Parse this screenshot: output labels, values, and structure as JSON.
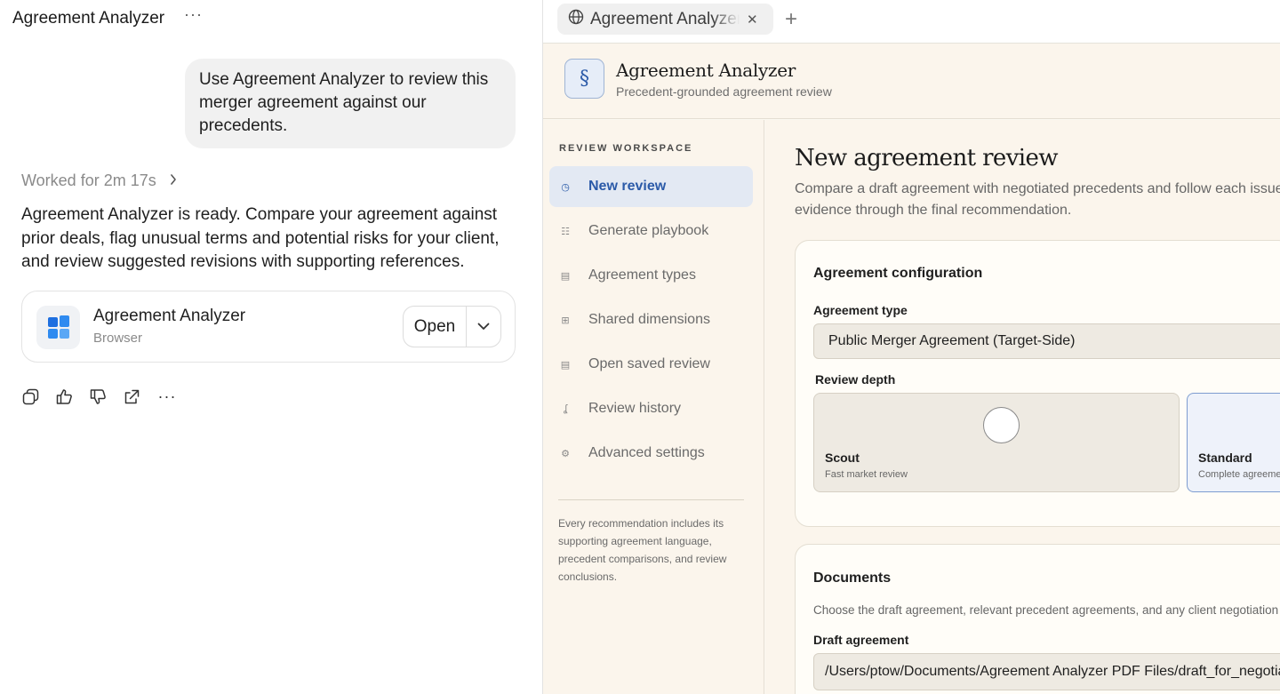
{
  "chat": {
    "title": "Agreement Analyzer",
    "more_glyph": "···",
    "user_message": "Use Agreement Analyzer to review this merger agreement against our precedents.",
    "worked_label": "Worked for 2m 17s",
    "assistant_message": "Agreement Analyzer is ready. Compare your agreement against prior deals, flag unusual terms and potential risks for your client, and review suggested revisions with supporting references.",
    "card": {
      "name": "Agreement Analyzer",
      "subtitle": "Browser",
      "open_label": "Open",
      "icon": "app-grid-icon"
    },
    "actions": [
      "copy-icon",
      "thumbs-up-icon",
      "thumbs-down-icon",
      "share-icon",
      "more-icon"
    ],
    "more_actions_glyph": "···"
  },
  "browser": {
    "tab_label": "Agreement Analyzer",
    "close_glyph": "✕",
    "new_tab_glyph": "+",
    "app": {
      "logo_glyph": "§",
      "title": "Agreement Analyzer",
      "subtitle": "Precedent-grounded agreement review"
    },
    "sidebar": {
      "heading": "REVIEW WORKSPACE",
      "items": [
        {
          "label": "New review",
          "icon": "clock-icon",
          "glyph": "◷",
          "active": true
        },
        {
          "label": "Generate playbook",
          "icon": "list-icon",
          "glyph": "☷",
          "active": false
        },
        {
          "label": "Agreement types",
          "icon": "document-icon",
          "glyph": "▤",
          "active": false
        },
        {
          "label": "Shared dimensions",
          "icon": "grid-icon",
          "glyph": "⊞",
          "active": false
        },
        {
          "label": "Open saved review",
          "icon": "folder-icon",
          "glyph": "▤",
          "active": false
        },
        {
          "label": "Review history",
          "icon": "history-icon",
          "glyph": "ʆ",
          "active": false
        },
        {
          "label": "Advanced settings",
          "icon": "gear-icon",
          "glyph": "⚙",
          "active": false
        }
      ],
      "note": "Every recommendation includes its supporting agreement language, precedent comparisons, and review conclusions."
    },
    "main": {
      "title": "New agreement review",
      "description": "Compare a draft agreement with negotiated precedents and follow each issue's evidence through the final recommendation.",
      "config": {
        "heading": "Agreement configuration",
        "type_label": "Agreement type",
        "type_value": "Public Merger Agreement (Target-Side)",
        "depth_label": "Review depth",
        "depth_options": [
          {
            "name": "Scout",
            "description": "Fast market review",
            "selected": false
          },
          {
            "name": "Standard",
            "description": "Complete agreement review",
            "selected": true
          }
        ]
      },
      "documents": {
        "heading": "Documents",
        "description": "Choose the draft agreement, relevant precedent agreements, and any client negotiation materials.",
        "draft_label": "Draft agreement",
        "draft_path": "/Users/ptow/Documents/Agreement Analyzer PDF Files/draft_for_negotiation.pdf"
      }
    }
  },
  "colors": {
    "accent": "#2b5aa8",
    "active_nav_bg": "#e3e9f3",
    "app_bg": "#fbf5ec",
    "bubble_bg": "#f1f1f1"
  }
}
